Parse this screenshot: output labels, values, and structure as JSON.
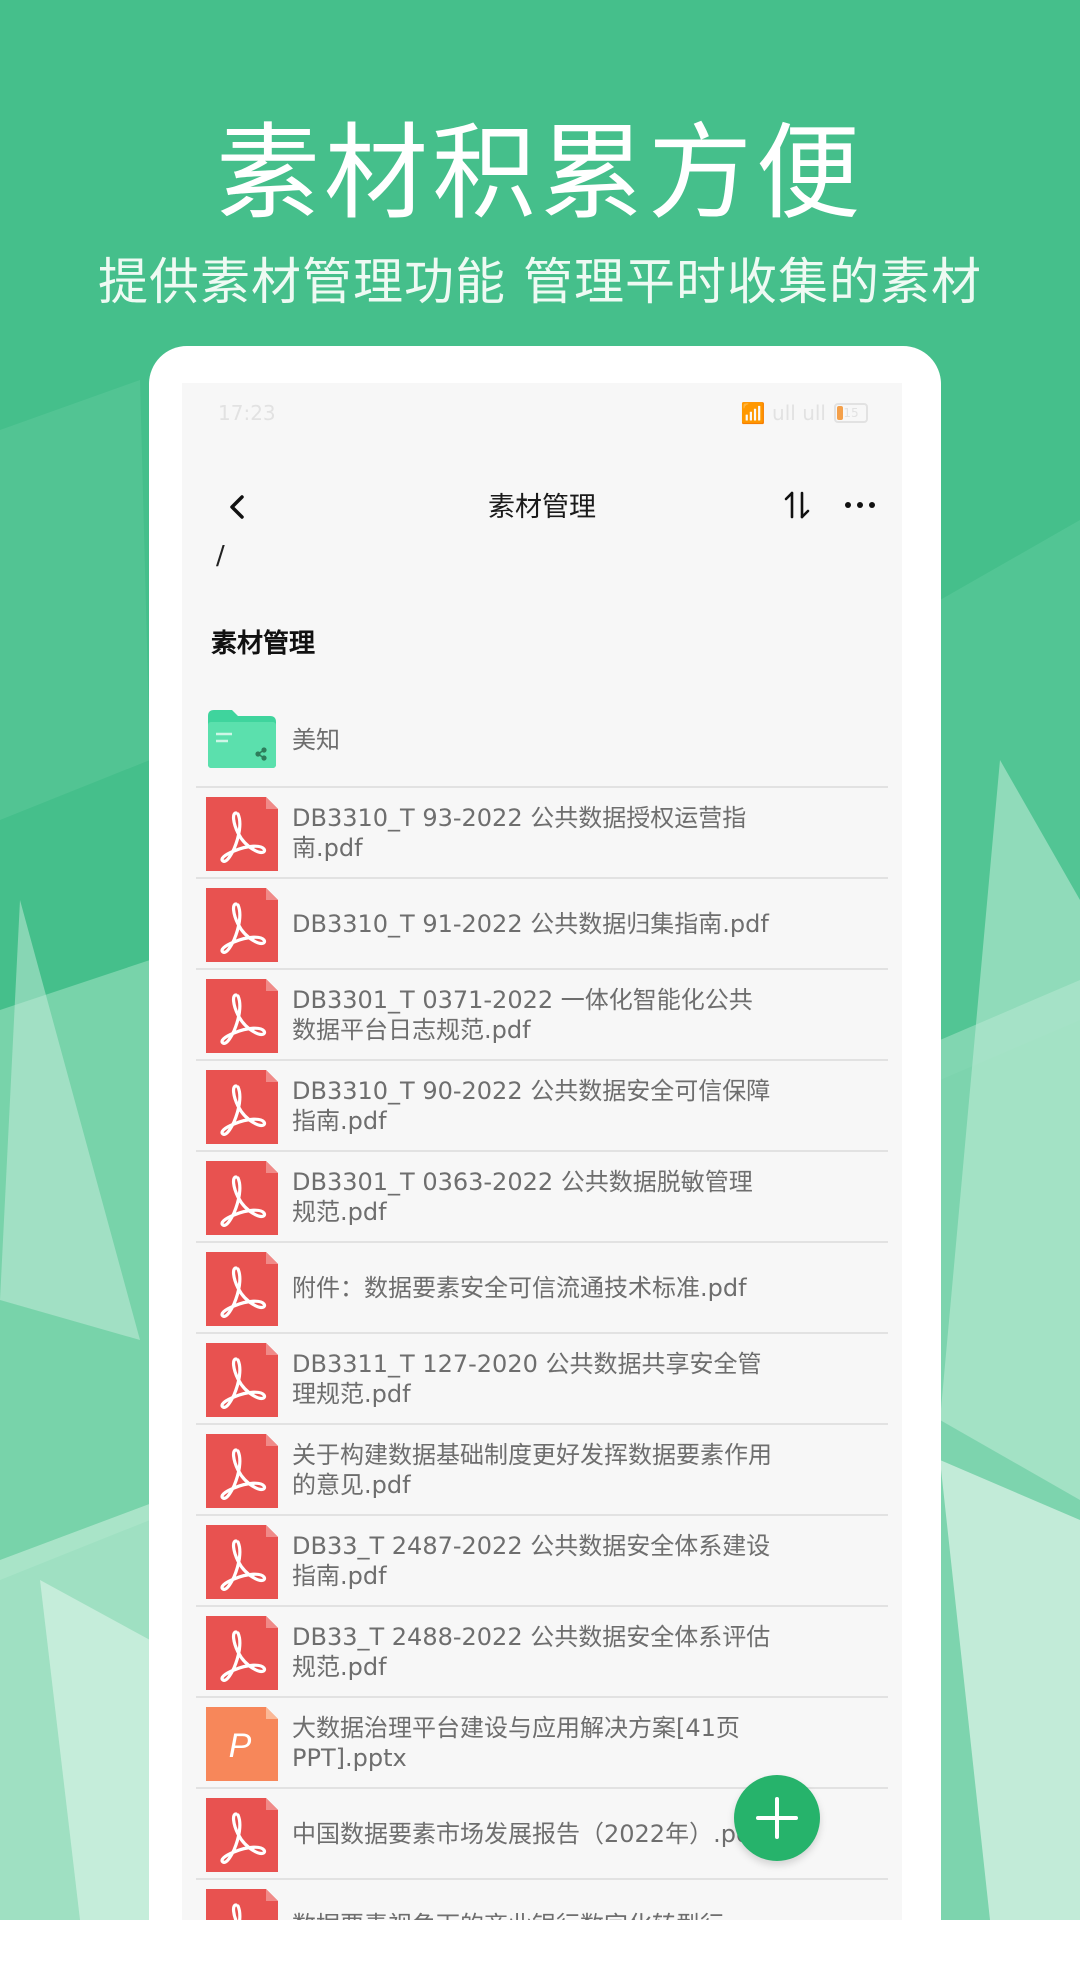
{
  "colors": {
    "background": "#45bf8b",
    "accent": "#26b36b",
    "pdf_icon": "#e85250",
    "ppt_icon": "#f7875a",
    "folder_icon": "#3fd49d"
  },
  "promo": {
    "headline": "素材积累方便",
    "subline": "提供素材管理功能  管理平时收集的素材"
  },
  "statusbar": {
    "time": "17:23",
    "signal": "📶 ull ull",
    "battery": "15"
  },
  "appbar": {
    "back_icon": "chevron-left-icon",
    "title": "素材管理",
    "sort_icon": "sort-icon",
    "more_icon": "more-icon"
  },
  "path": "/",
  "section_title": "素材管理",
  "files": [
    {
      "name": "美知",
      "type": "folder"
    },
    {
      "name": "DB3310_T 93-2022 公共数据授权运营指南.pdf",
      "type": "pdf"
    },
    {
      "name": "DB3310_T 91-2022 公共数据归集指南.pdf",
      "type": "pdf"
    },
    {
      "name": "DB3301_T 0371-2022 一体化智能化公共数据平台日志规范.pdf",
      "type": "pdf"
    },
    {
      "name": "DB3310_T 90-2022 公共数据安全可信保障指南.pdf",
      "type": "pdf"
    },
    {
      "name": "DB3301_T 0363-2022 公共数据脱敏管理规范.pdf",
      "type": "pdf"
    },
    {
      "name": "附件：数据要素安全可信流通技术标准.pdf",
      "type": "pdf"
    },
    {
      "name": "DB3311_T 127-2020 公共数据共享安全管理规范.pdf",
      "type": "pdf"
    },
    {
      "name": "关于构建数据基础制度更好发挥数据要素作用的意见.pdf",
      "type": "pdf"
    },
    {
      "name": "DB33_T 2487-2022 公共数据安全体系建设指南.pdf",
      "type": "pdf"
    },
    {
      "name": "DB33_T 2488-2022 公共数据安全体系评估规范.pdf",
      "type": "pdf"
    },
    {
      "name": "大数据治理平台建设与应用解决方案[41页PPT].pptx",
      "type": "ppt",
      "icon_letter": "P"
    },
    {
      "name": "中国数据要素市场发展报告（2022年）.pdf",
      "type": "pdf"
    },
    {
      "name": "数据要素视角下的商业银行数字化转型行",
      "type": "pdf"
    }
  ],
  "fab": {
    "icon": "plus-icon"
  }
}
